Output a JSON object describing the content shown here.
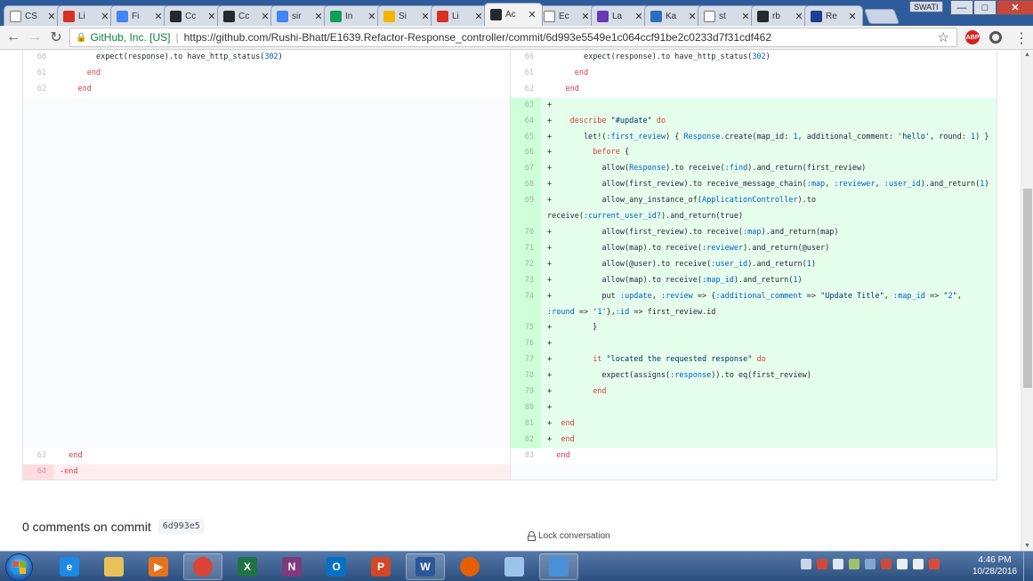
{
  "browser": {
    "tabs": [
      {
        "title": "CS",
        "favicon": "document-icon",
        "color": "#ffffff"
      },
      {
        "title": "Li",
        "favicon": "gmail-icon",
        "color": "#d93025"
      },
      {
        "title": "Fi",
        "favicon": "google-docs-icon",
        "color": "#4285f4"
      },
      {
        "title": "Cc",
        "favicon": "github-icon",
        "color": "#24292e"
      },
      {
        "title": "Cc",
        "favicon": "github-icon",
        "color": "#24292e"
      },
      {
        "title": "sir",
        "favicon": "google-icon",
        "color": "#4285f4"
      },
      {
        "title": "In",
        "favicon": "google-sheets-icon",
        "color": "#0f9d58"
      },
      {
        "title": "Si",
        "favicon": "slides-icon",
        "color": "#f4b400"
      },
      {
        "title": "Li",
        "favicon": "gmail-icon",
        "color": "#d93025"
      },
      {
        "title": "Ac",
        "favicon": "github-icon",
        "color": "#24292e",
        "active": true
      },
      {
        "title": "Ec",
        "favicon": "document-icon",
        "color": "#ffffff"
      },
      {
        "title": "La",
        "favicon": "forms-icon",
        "color": "#673ab7"
      },
      {
        "title": "Ka",
        "favicon": "kahoot-icon",
        "color": "#2a6fbf"
      },
      {
        "title": "st",
        "favicon": "document-icon",
        "color": "#ffffff"
      },
      {
        "title": "rb",
        "favicon": "github-icon",
        "color": "#24292e"
      },
      {
        "title": "Re",
        "favicon": "ri-icon",
        "color": "#1c3f94"
      }
    ],
    "user_badge": "SWATI",
    "address": {
      "org": "GitHub, Inc. [US]",
      "separator": "|",
      "url": "https://github.com/Rushi-Bhatt/E1639.Refactor-Response_controller/commit/6d993e5549e1c064ccf91be2c0233d7f31cdf462"
    },
    "abp_label": "ABP"
  },
  "diff": {
    "rows": [
      {
        "left_num": "60",
        "left": "        expect(response).to have_http_status(302)",
        "right_num": "60",
        "right": "        expect(response).to have_http_status(302)",
        "left_type": "ctx",
        "right_type": "ctx"
      },
      {
        "left_num": "61",
        "left": "      end",
        "right_num": "61",
        "right": "      end",
        "left_type": "ctx",
        "right_type": "ctx"
      },
      {
        "left_num": "62",
        "left": "    end",
        "right_num": "62",
        "right": "    end",
        "left_type": "ctx",
        "right_type": "ctx"
      },
      {
        "left_num": "",
        "left": "",
        "right_num": "63",
        "right": "+",
        "left_type": "empty",
        "right_type": "add"
      },
      {
        "left_num": "",
        "left": "",
        "right_num": "64",
        "right": "+    describe \"#update\" do",
        "left_type": "empty",
        "right_type": "add"
      },
      {
        "left_num": "",
        "left": "",
        "right_num": "65",
        "right": "+       let!(:first_review) { Response.create(map_id: 1, additional_comment: 'hello', round: 1) }",
        "left_type": "empty",
        "right_type": "add"
      },
      {
        "left_num": "",
        "left": "",
        "right_num": "66",
        "right": "+         before {",
        "left_type": "empty",
        "right_type": "add"
      },
      {
        "left_num": "",
        "left": "",
        "right_num": "67",
        "right": "+           allow(Response).to receive(:find).and_return(first_review)",
        "left_type": "empty",
        "right_type": "add"
      },
      {
        "left_num": "",
        "left": "",
        "right_num": "68",
        "right": "+           allow(first_review).to receive_message_chain(:map, :reviewer, :user_id).and_return(1)",
        "left_type": "empty",
        "right_type": "add"
      },
      {
        "left_num": "",
        "left": "",
        "right_num": "69",
        "right": "+           allow_any_instance_of(ApplicationController).to receive(:current_user_id?).and_return(true)",
        "left_type": "empty",
        "right_type": "add"
      },
      {
        "left_num": "",
        "left": "",
        "right_num": "70",
        "right": "+           allow(first_review).to receive(:map).and_return(map)",
        "left_type": "empty",
        "right_type": "add"
      },
      {
        "left_num": "",
        "left": "",
        "right_num": "71",
        "right": "+           allow(map).to receive(:reviewer).and_return(@user)",
        "left_type": "empty",
        "right_type": "add"
      },
      {
        "left_num": "",
        "left": "",
        "right_num": "72",
        "right": "+           allow(@user).to receive(:user_id).and_return(1)",
        "left_type": "empty",
        "right_type": "add"
      },
      {
        "left_num": "",
        "left": "",
        "right_num": "73",
        "right": "+           allow(map).to receive(:map_id).and_return(1)",
        "left_type": "empty",
        "right_type": "add"
      },
      {
        "left_num": "",
        "left": "",
        "right_num": "74",
        "right": "+           put :update, :review => {:additional_comment => \"Update Title\", :map_id => \"2\", :round => '1'},:id => first_review.id",
        "left_type": "empty",
        "right_type": "add"
      },
      {
        "left_num": "",
        "left": "",
        "right_num": "75",
        "right": "+         }",
        "left_type": "empty",
        "right_type": "add"
      },
      {
        "left_num": "",
        "left": "",
        "right_num": "76",
        "right": "+",
        "left_type": "empty",
        "right_type": "add"
      },
      {
        "left_num": "",
        "left": "",
        "right_num": "77",
        "right": "+         it \"located the requested response\" do",
        "left_type": "empty",
        "right_type": "add"
      },
      {
        "left_num": "",
        "left": "",
        "right_num": "78",
        "right": "+           expect(assigns(:response)).to eq(first_review)",
        "left_type": "empty",
        "right_type": "add"
      },
      {
        "left_num": "",
        "left": "",
        "right_num": "79",
        "right": "+         end",
        "left_type": "empty",
        "right_type": "add"
      },
      {
        "left_num": "",
        "left": "",
        "right_num": "80",
        "right": "+",
        "left_type": "empty",
        "right_type": "add"
      },
      {
        "left_num": "",
        "left": "",
        "right_num": "81",
        "right": "+  end",
        "left_type": "empty",
        "right_type": "add"
      },
      {
        "left_num": "",
        "left": "",
        "right_num": "82",
        "right": "+  end",
        "left_type": "empty",
        "right_type": "add"
      },
      {
        "left_num": "63",
        "left": "  end",
        "right_num": "83",
        "right": "  end",
        "left_type": "ctx",
        "right_type": "ctx"
      },
      {
        "left_num": "64",
        "left": "-end",
        "right_num": "",
        "right": "",
        "left_type": "del",
        "right_type": "empty"
      }
    ]
  },
  "comments": {
    "label": "0 comments on commit",
    "sha": "6d993e5",
    "lock_label": "Lock conversation"
  },
  "taskbar": {
    "apps": [
      {
        "name": "ie-icon",
        "label": "e",
        "color": "#1e88e5"
      },
      {
        "name": "explorer-icon",
        "label": "",
        "color": "#e8c15a"
      },
      {
        "name": "media-player-icon",
        "label": "▶",
        "color": "#e8731a"
      },
      {
        "name": "chrome-icon",
        "label": "",
        "color": "#db4437",
        "running": true
      },
      {
        "name": "excel-icon",
        "label": "X",
        "color": "#1f7244"
      },
      {
        "name": "onenote-icon",
        "label": "N",
        "color": "#80397b"
      },
      {
        "name": "outlook-icon",
        "label": "O",
        "color": "#0072c6"
      },
      {
        "name": "powerpoint-icon",
        "label": "P",
        "color": "#d24726"
      },
      {
        "name": "word-icon",
        "label": "W",
        "color": "#2b579a",
        "running": true
      },
      {
        "name": "firefox-icon",
        "label": "",
        "color": "#e66000"
      },
      {
        "name": "paint-icon",
        "label": "",
        "color": "#9bc4e8"
      },
      {
        "name": "photo-viewer-icon",
        "label": "",
        "color": "#4a90d9",
        "running": true
      }
    ],
    "time": "4:46 PM",
    "date": "10/28/2016"
  }
}
